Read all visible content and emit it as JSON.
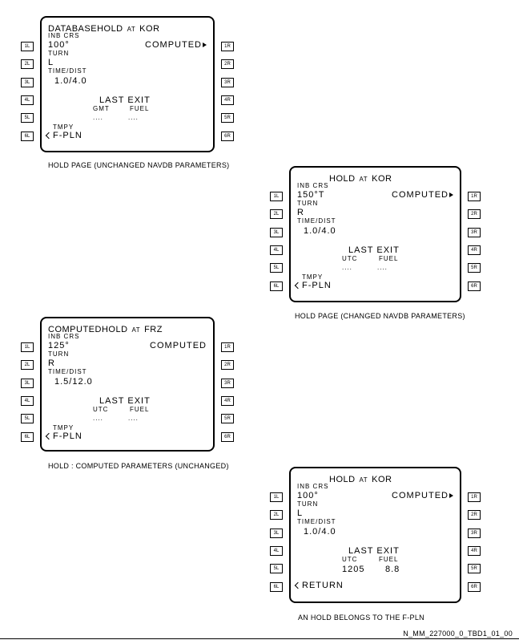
{
  "lsk": {
    "l": [
      "1L",
      "2L",
      "3L",
      "4L",
      "5L",
      "6L"
    ],
    "r": [
      "1R",
      "2R",
      "3R",
      "4R",
      "5R",
      "6R"
    ]
  },
  "screens": [
    {
      "title_prefix": "DATABASE",
      "title_main": "HOLD",
      "title_at": "AT",
      "title_wpt": "KOR",
      "inb_label": "INB CRS",
      "inb_value": "100°",
      "computed": "COMPUTED",
      "computed_arrow": true,
      "turn_label": "TURN",
      "turn_value": "L",
      "time_label": "TIME/DIST",
      "time_value": "1.0/4.0",
      "last_exit": "LAST EXIT",
      "col1": "GMT",
      "col2": "FUEL",
      "val1": "....",
      "val2": "....",
      "tmpy": "TMPY",
      "bottom": "F-PLN",
      "caption": "HOLD PAGE (UNCHANGED NAVDB PARAMETERS)"
    },
    {
      "title_prefix": "",
      "title_main": "HOLD",
      "title_at": "AT",
      "title_wpt": "KOR",
      "inb_label": "INB CRS",
      "inb_value": "150°T",
      "computed": "COMPUTED",
      "computed_arrow": true,
      "turn_label": "TURN",
      "turn_value": "R",
      "time_label": "TIME/DIST",
      "time_value": "1.0/4.0",
      "last_exit": "LAST EXIT",
      "col1": "UTC",
      "col2": "FUEL",
      "val1": "....",
      "val2": "....",
      "tmpy": "TMPY",
      "bottom": "F-PLN",
      "caption": "HOLD PAGE (CHANGED NAVDB PARAMETERS)"
    },
    {
      "title_prefix": "COMPUTED",
      "title_main": "HOLD",
      "title_at": "AT",
      "title_wpt": "FRZ",
      "inb_label": "INB CRS",
      "inb_value": "125°",
      "computed": "COMPUTED",
      "computed_arrow": false,
      "turn_label": "TURN",
      "turn_value": "R",
      "time_label": "TIME/DIST",
      "time_value": "1.5/12.0",
      "last_exit": "LAST EXIT",
      "col1": "UTC",
      "col2": "FUEL",
      "val1": "....",
      "val2": "....",
      "tmpy": "TMPY",
      "bottom": "F-PLN",
      "caption": "HOLD : COMPUTED PARAMETERS (UNCHANGED)"
    },
    {
      "title_prefix": "",
      "title_main": "HOLD",
      "title_at": "AT",
      "title_wpt": "KOR",
      "inb_label": "INB CRS",
      "inb_value": "100°",
      "computed": "COMPUTED",
      "computed_arrow": true,
      "turn_label": "TURN",
      "turn_value": "L",
      "time_label": "TIME/DIST",
      "time_value": "1.0/4.0",
      "last_exit": "LAST EXIT",
      "col1": "UTC",
      "col2": "FUEL",
      "val1": "1205",
      "val2": "8.8",
      "tmpy": "",
      "bottom": "RETURN",
      "caption": "AN HOLD BELONGS TO THE F-PLN"
    }
  ],
  "reference": "N_MM_227000_0_TBD1_01_00"
}
